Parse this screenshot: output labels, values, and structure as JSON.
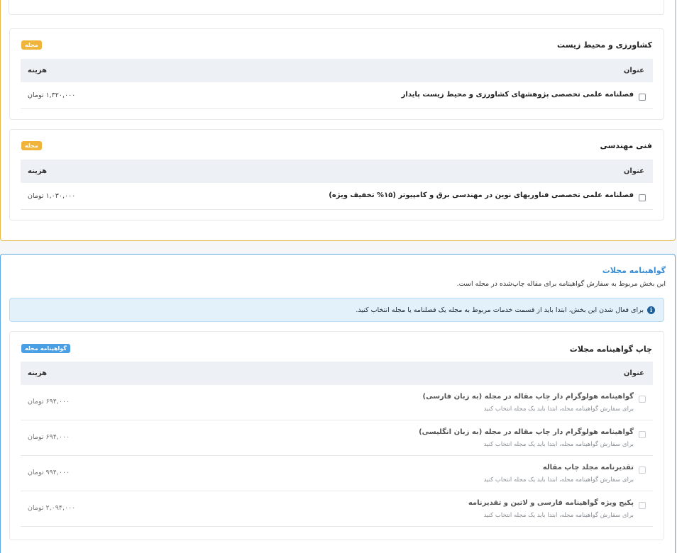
{
  "journal_section": {
    "groups": [
      {
        "title": "کشاورزی و محیط زیست",
        "badge": "مجله",
        "col_title": "عنوان",
        "col_cost": "هزینه",
        "items": [
          {
            "title": "فصلنامه علمی تخصصی پژوهشهای کشاورزی و محیط زیست پایدار",
            "cost": "۱,۳۲۰,۰۰۰ تومان",
            "checked": false
          }
        ]
      },
      {
        "title": "فنی مهندسی",
        "badge": "مجله",
        "col_title": "عنوان",
        "col_cost": "هزینه",
        "items": [
          {
            "title": "فصلنامه علمی تخصصی فناوریهای نوین در مهندسی برق و کامپیوتر (۱۵% تخفیف ویژه)",
            "cost": "۱,۰۳۰,۰۰۰ تومان",
            "checked": false
          }
        ]
      }
    ]
  },
  "certificate_section": {
    "title": "گواهینامه مجلات",
    "description": "این بخش مربوط به سفارش گواهینامه برای مقاله چاپ‌شده در مجله است.",
    "alert_icon": "info-circle-icon",
    "alert": "برای فعال شدن این بخش، ابتدا باید از قسمت خدمات مربوط به مجله یک فصلنامه یا مجله انتخاب کنید.",
    "card": {
      "title": "چاپ گواهینامه مجلات",
      "badge": "گواهینامه مجله",
      "col_title": "عنوان",
      "col_cost": "هزینه",
      "items": [
        {
          "title": "گواهینامه هولوگرام دار چاپ مقاله در مجله (به زبان فارسی)",
          "note": "برای سفارش گواهینامه مجله، ابتدا باید یک مجله انتخاب کنید",
          "cost": "۶۹۴,۰۰۰ تومان",
          "disabled": true
        },
        {
          "title": "گواهینامه هولوگرام دار چاپ مقاله در مجله (به زبان انگلیسی)",
          "note": "برای سفارش گواهینامه مجله، ابتدا باید یک مجله انتخاب کنید",
          "cost": "۶۹۴,۰۰۰ تومان",
          "disabled": true
        },
        {
          "title": "تقدیرنامه مجلد چاپ مقاله",
          "note": "برای سفارش گواهینامه مجله، ابتدا باید یک مجله انتخاب کنید",
          "cost": "۹۹۴,۰۰۰ تومان",
          "disabled": true
        },
        {
          "title": "پکیج ویژه گواهینامه فارسی و لاتین و تقدیرنامه",
          "note": "برای سفارش گواهینامه مجله، ابتدا باید یک مجله انتخاب کنید",
          "cost": "۲,۰۹۴,۰۰۰ تومان",
          "disabled": true
        }
      ]
    }
  },
  "colors": {
    "journal_border": "#e8b84a",
    "journal_badge": "#f0b43a",
    "certificate_border": "#5ba9e0",
    "certificate_badge": "#4a9ee3",
    "certificate_title": "#3a8fd6",
    "alert_background": "#e3f1fb"
  }
}
